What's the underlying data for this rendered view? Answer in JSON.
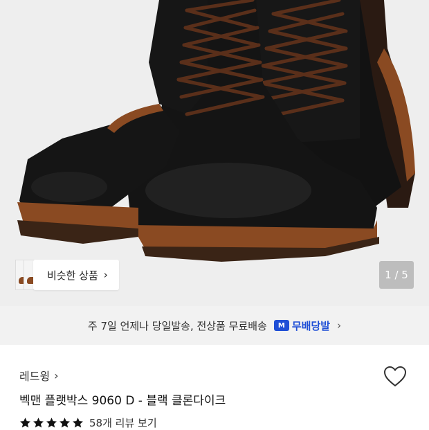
{
  "gallery": {
    "current": 1,
    "total": 5,
    "counter_text": "1 / 5",
    "similar_label": "비슷한 상품",
    "similar_chevron": "›"
  },
  "delivery": {
    "text": "주 7일 언제나 당일발송, 전상품 무료배송",
    "badge_label": "무배당발",
    "badge_icon_letter": "M",
    "chevron": "›"
  },
  "product": {
    "brand": "레드윙",
    "brand_chevron": "›",
    "name": "벡맨 플랫박스 9060 D - 블랙 클론다이크",
    "rating_stars": 5,
    "review_text": "58개 리뷰 보기"
  },
  "colors": {
    "hero_bg": "#eeeeee",
    "boot_leather": "#151515",
    "lace": "#5a2f1a",
    "welt": "#8a4a22",
    "accent_blue": "#1f4fd6",
    "star": "#111111"
  },
  "icons": {
    "wishlist": "heart-outline-icon",
    "star": "star-icon",
    "delivery_badge": "delivery-m-icon"
  }
}
